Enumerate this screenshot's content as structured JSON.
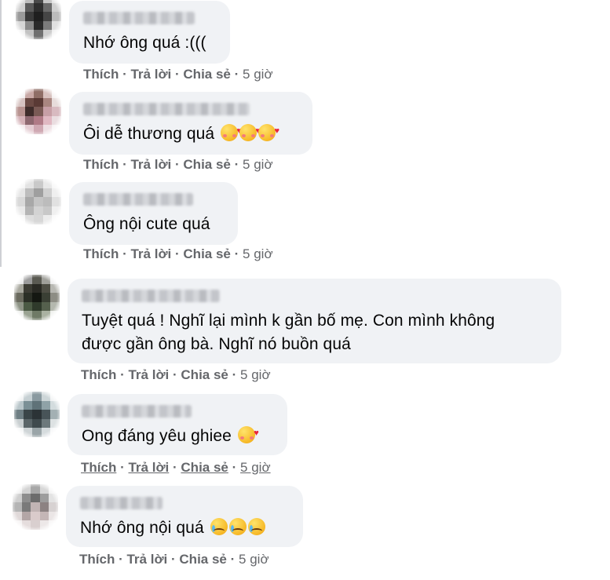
{
  "comments": [
    {
      "text": "Nhớ ông quá :(((",
      "emojis": [],
      "actions": {
        "like": "Thích",
        "reply": "Trả lời",
        "share": "Chia sẻ",
        "sep": "·",
        "time": "5 giờ"
      }
    },
    {
      "text": "Ôi dễ thương quá",
      "emojis": [
        "smiling-face-with-hearts",
        "smiling-face-with-hearts",
        "smiling-face-with-hearts"
      ],
      "actions": {
        "like": "Thích",
        "reply": "Trả lời",
        "share": "Chia sẻ",
        "sep": "·",
        "time": "5 giờ"
      }
    },
    {
      "text": "Ông nội cute quá",
      "emojis": [],
      "actions": {
        "like": "Thích",
        "reply": "Trả lời",
        "share": "Chia sẻ",
        "sep": "·",
        "time": "5 giờ"
      }
    },
    {
      "text": "Tuyệt quá ! Nghĩ lại mình k gần bố mẹ. Con mình không\nđược gần ông bà. Nghĩ nó buồn quá",
      "emojis": [],
      "actions": {
        "like": "Thích",
        "reply": "Trả lời",
        "share": "Chia sẻ",
        "sep": "·",
        "time": "5 giờ"
      }
    },
    {
      "text": "Ong đáng yêu ghiee",
      "emojis": [
        "smiling-face-with-hearts"
      ],
      "actions": {
        "like": "Thích",
        "reply": "Trả lời",
        "share": "Chia sẻ",
        "sep": "·",
        "time": "5 giờ"
      }
    },
    {
      "text": "Nhớ ông nội quá",
      "emojis": [
        "crying-face",
        "crying-face",
        "crying-face"
      ],
      "actions": {
        "like": "Thích",
        "reply": "Trả lời",
        "share": "Chia sẻ",
        "sep": "·",
        "time": "5 giờ"
      }
    }
  ],
  "colors": {
    "bubble_bg": "#f0f2f5",
    "action_text": "#65676b",
    "body_text": "#050505"
  }
}
